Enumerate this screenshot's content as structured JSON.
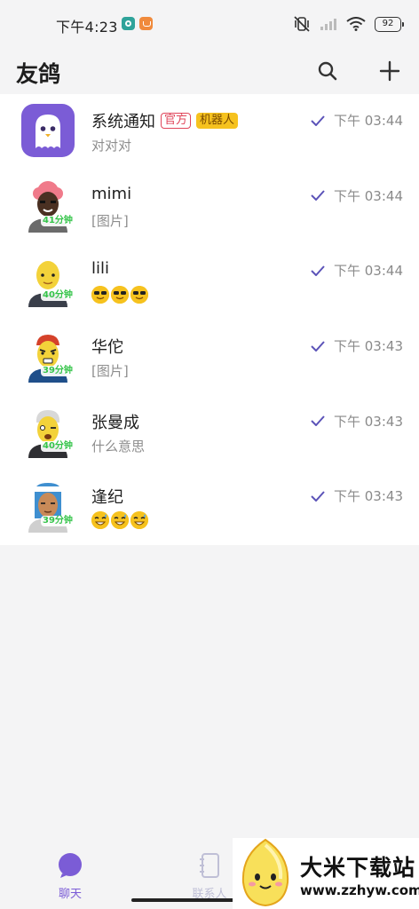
{
  "status_bar": {
    "time": "下午4:23",
    "battery": "92"
  },
  "header": {
    "title": "友鸽",
    "search_icon": "search-icon",
    "add_icon": "plus-icon"
  },
  "colors": {
    "accent": "#7b5cd6",
    "online_green": "#35c44a",
    "official_red": "#e0455a",
    "robot_yellow": "#f6c21e"
  },
  "chats": [
    {
      "name": "系统通知",
      "tag_official": "官方",
      "tag_robot": "机器人",
      "preview": "对对对",
      "time": "下午 03:44",
      "online": ""
    },
    {
      "name": "mimi",
      "preview": "[图片]",
      "time": "下午 03:44",
      "online": "41分钟"
    },
    {
      "name": "lili",
      "preview": "",
      "preview_emojis": [
        "sunglasses-emoji",
        "sunglasses-emoji",
        "sunglasses-emoji"
      ],
      "time": "下午 03:44",
      "online": "40分钟"
    },
    {
      "name": "华佗",
      "preview": "[图片]",
      "time": "下午 03:43",
      "online": "39分钟"
    },
    {
      "name": "张曼成",
      "preview": "什么意思",
      "time": "下午 03:43",
      "online": "40分钟"
    },
    {
      "name": "逢纪",
      "preview": "",
      "preview_emojis": [
        "sweat-smile-emoji",
        "sweat-smile-emoji",
        "sweat-smile-emoji"
      ],
      "time": "下午 03:43",
      "online": "39分钟"
    }
  ],
  "tabs": [
    {
      "label": "聊天",
      "active": true
    },
    {
      "label": "联系人",
      "active": false
    }
  ],
  "watermark": {
    "title": "大米下载站",
    "url": "www.zzhyw.com"
  }
}
